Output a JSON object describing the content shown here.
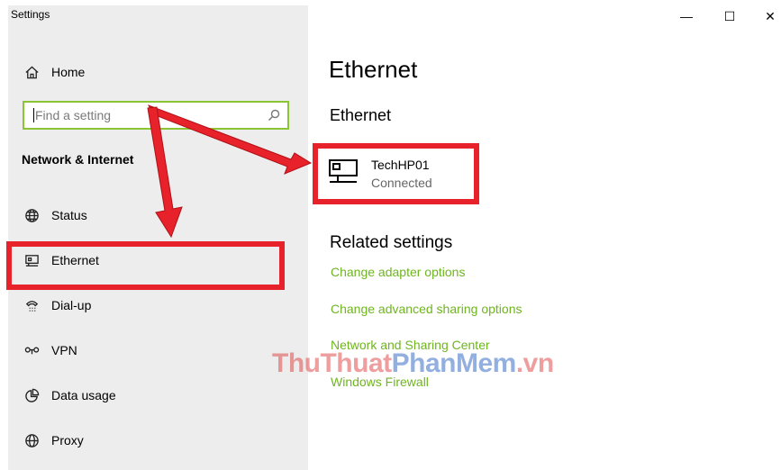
{
  "window": {
    "title": "Settings",
    "minimize_glyph": "—",
    "maximize_glyph": "☐",
    "close_glyph": "✕"
  },
  "sidebar": {
    "home_label": "Home",
    "search_placeholder": "Find a setting",
    "section_title": "Network & Internet",
    "items": [
      {
        "label": "Status",
        "icon": "globe-icon"
      },
      {
        "label": "Ethernet",
        "icon": "ethernet-icon"
      },
      {
        "label": "Dial-up",
        "icon": "phone-icon"
      },
      {
        "label": "VPN",
        "icon": "vpn-icon"
      },
      {
        "label": "Data usage",
        "icon": "data-usage-icon"
      },
      {
        "label": "Proxy",
        "icon": "globe-icon"
      }
    ]
  },
  "main": {
    "page_title": "Ethernet",
    "section_title": "Ethernet",
    "device": {
      "name": "TechHP01",
      "status": "Connected"
    },
    "related_title": "Related settings",
    "links": [
      "Change adapter options",
      "Change advanced sharing options",
      "Network and Sharing Center",
      "Windows Firewall"
    ]
  },
  "watermark": {
    "part1": "ThuThuat",
    "part2": "PhanMem",
    "part3": ".vn"
  },
  "colors": {
    "accent_green": "#6fb51f",
    "search_border": "#8ac634",
    "annotation_red": "#e8222a",
    "sidebar_bg": "#ededed"
  }
}
